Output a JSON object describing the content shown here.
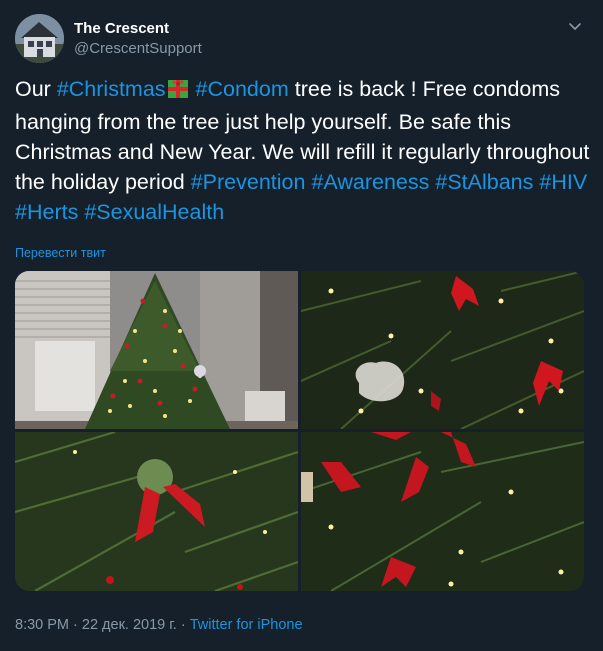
{
  "author": {
    "display_name": "The Crescent",
    "handle": "@CrescentSupport",
    "avatar_icon": "house-photo"
  },
  "menu": {
    "icon": "chevron-down-icon"
  },
  "tweet": {
    "t1": "Our ",
    "tag_christmas": "#Christmas",
    "emoji": "wrapped-gift",
    "t2": " ",
    "tag_condom": "#Condom",
    "t3": " tree is back ! Free condoms hanging from the tree just help yourself. Be safe this Christmas and New Year. We will refill it regularly throughout the holiday period ",
    "tag_prevention": "#Prevention",
    "t4": " ",
    "tag_awareness": "#Awareness",
    "t5": " ",
    "tag_stalbans": "#StAlbans",
    "t6": " ",
    "tag_hiv": "#HIV",
    "t7": " ",
    "tag_herts": "#Herts",
    "t8": " ",
    "tag_sexualhealth": "#SexualHealth"
  },
  "translate_label": "Перевести твит",
  "media": {
    "photos": [
      "christmas-tree-by-window",
      "red-ribbon-and-condoms-bag-on-tree",
      "red-ribbon-close-up",
      "red-ribbons-on-branches"
    ]
  },
  "meta": {
    "time": "8:30 PM",
    "sep1": " · ",
    "date": "22 дек. 2019 г.",
    "sep2": " · ",
    "source": "Twitter for iPhone"
  },
  "colors": {
    "background": "#15202b",
    "link": "#1b95e0",
    "secondary_text": "#8899a6"
  }
}
